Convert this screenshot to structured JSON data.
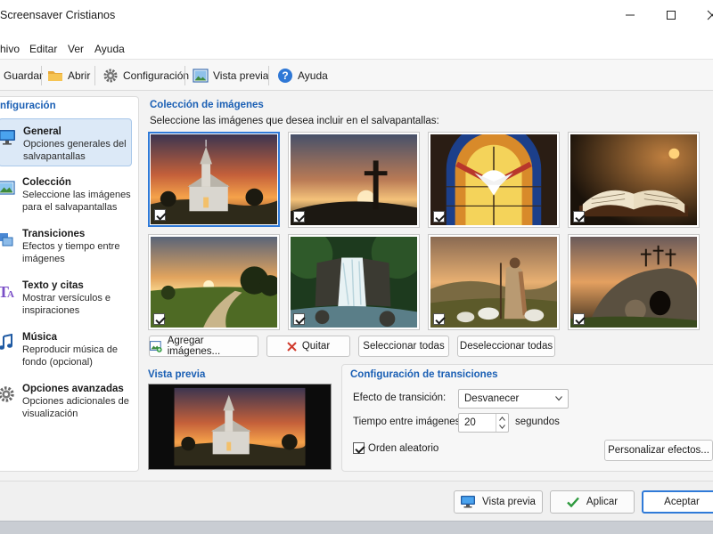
{
  "window": {
    "title": "Screensaver Cristianos"
  },
  "menu": [
    "hivo",
    "Editar",
    "Ver",
    "Ayuda"
  ],
  "toolbar": {
    "save": "Guardar",
    "open": "Abrir",
    "config": "Configuración",
    "preview": "Vista previa",
    "help": "Ayuda"
  },
  "sidebar": {
    "heading": "nfiguración",
    "items": [
      {
        "title": "General",
        "desc": "Opciones generales del salvapantallas",
        "icon": "monitor-icon"
      },
      {
        "title": "Colección",
        "desc": "Seleccione las imágenes para el salvapantallas",
        "icon": "image-icon"
      },
      {
        "title": "Transiciones",
        "desc": "Efectos y tiempo entre imágenes",
        "icon": "transition-icon"
      },
      {
        "title": "Texto y citas",
        "desc": "Mostrar versículos e inspiraciones",
        "icon": "text-icon"
      },
      {
        "title": "Música",
        "desc": "Reproducir música de fondo (opcional)",
        "icon": "music-icon"
      },
      {
        "title": "Opciones avanzadas",
        "desc": "Opciones adicionales de visualización",
        "icon": "gear-icon"
      }
    ]
  },
  "collection": {
    "title": "Colección de imágenes",
    "instruction": "Seleccione las imágenes que desea incluir en el salvapantallas:",
    "buttons": {
      "add": "Agregar imágenes...",
      "remove": "Quitar",
      "select_all": "Seleccionar todas",
      "deselect_all": "Deseleccionar todas"
    }
  },
  "preview": {
    "title": "Vista previa"
  },
  "transitions": {
    "title": "Configuración de transiciones",
    "effect_label": "Efecto de transición:",
    "effect_value": "Desvanecer",
    "time_label": "Tiempo entre imágenes:",
    "time_value": "20",
    "time_unit": "segundos",
    "random_label": "Orden aleatorio",
    "customize": "Personalizar efectos..."
  },
  "footer": {
    "preview": "Vista previa",
    "apply": "Aplicar",
    "accept": "Aceptar"
  },
  "colors": {
    "accent": "#1a5fb4",
    "selection": "#2f7ad8"
  }
}
